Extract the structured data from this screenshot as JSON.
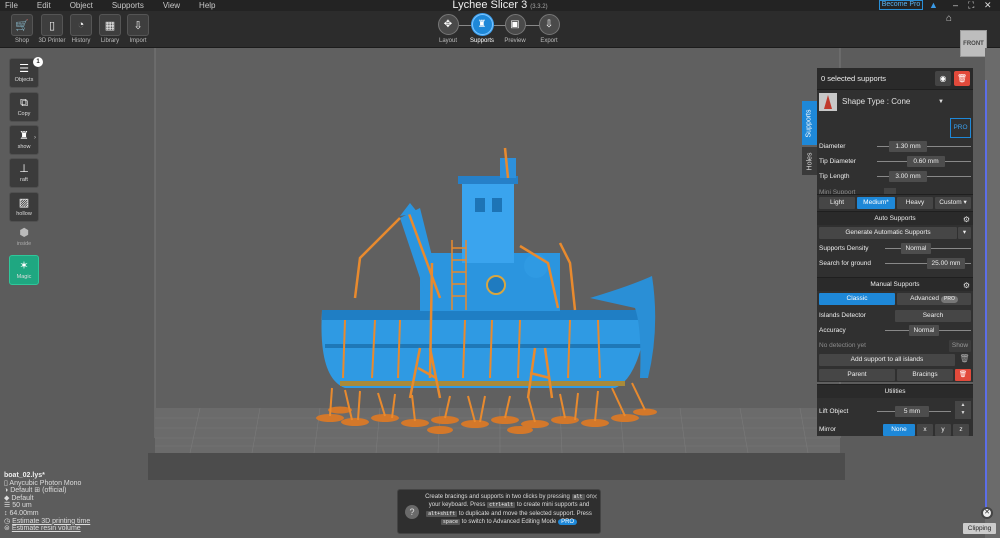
{
  "app": {
    "title": "Lychee Slicer 3",
    "version": "(3.3.2)",
    "become_pro": "Become Pro"
  },
  "menu": [
    "File",
    "Edit",
    "Object",
    "Supports",
    "View",
    "Help"
  ],
  "toolbar": {
    "tools": [
      {
        "label": "Shop",
        "icon": "cart-icon"
      },
      {
        "label": "3D Printer",
        "icon": "printer-icon"
      },
      {
        "label": "History",
        "icon": "history-icon"
      },
      {
        "label": "Library",
        "icon": "library-icon"
      },
      {
        "label": "Import",
        "icon": "import-icon"
      }
    ],
    "steps": [
      {
        "label": "Layout",
        "active": false
      },
      {
        "label": "Supports",
        "active": true
      },
      {
        "label": "Preview",
        "active": false
      },
      {
        "label": "Export",
        "active": false
      }
    ]
  },
  "left_tools": [
    {
      "label": "Objects",
      "icon": "list-icon"
    },
    {
      "label": "Copy",
      "icon": "copy-icon"
    },
    {
      "label": "show",
      "icon": "show-icon"
    },
    {
      "label": "raft",
      "icon": "raft-icon"
    },
    {
      "label": "hollow",
      "icon": "hollow-icon"
    },
    {
      "label": "inside",
      "icon": "inside-icon"
    },
    {
      "label": "Magic",
      "icon": "magic-icon"
    }
  ],
  "objects_count": "1",
  "viewcube_label": "FRONT",
  "file_info": {
    "filename": "boat_02.lys*",
    "printer": "Anycubic Photon Mono",
    "resin": "Default",
    "resin_suffix": "(official)",
    "profile": "Default",
    "layer_height": "50 um",
    "height": "64.00mm",
    "estimate_time": "Estimate 3D printing time",
    "estimate_resin": "Estimate resin volume"
  },
  "tip": {
    "part1": "Create bracings and supports in two clicks by pressing",
    "key_alt": "alt",
    "part2": "on your keyboard. Press",
    "key_ctrl_alt": "ctrl+alt",
    "part3": "to create mini supports and",
    "key_alt_shift": "alt+shift",
    "part4": "to duplicate and move the selected support.",
    "part5": "Press",
    "key_space": "space",
    "part6": "to switch to Advanced Editing Mode",
    "pro": "PRO"
  },
  "side_tabs": {
    "supports": "Supports",
    "holes": "Holes"
  },
  "panel": {
    "selected": "0 selected supports",
    "shape_type": "Shape Type : Cone",
    "pro": "PRO",
    "diameter_label": "Diameter",
    "diameter": "1.30 mm",
    "tip_diameter_label": "Tip Diameter",
    "tip_diameter": "0.60 mm",
    "tip_length_label": "Tip Length",
    "tip_length": "3.00 mm",
    "mini_support": "Mini Support",
    "presets": [
      "Light",
      "Medium*",
      "Heavy",
      "Custom ▾"
    ],
    "auto_title": "Auto Supports",
    "generate": "Generate Automatic Supports",
    "density_label": "Supports Density",
    "density": "Normal",
    "search_ground_label": "Search for ground",
    "search_ground": "25.00 mm",
    "manual_title": "Manual Supports",
    "classic": "Classic",
    "advanced": "Advanced",
    "adv_pro": "PRO",
    "islands_label": "Islands Detector",
    "search": "Search",
    "accuracy_label": "Accuracy",
    "accuracy": "Normal",
    "no_detection": "No detection yet",
    "show": "Show",
    "add_all": "Add support to all islands",
    "parent": "Parent",
    "bracings": "Bracings",
    "utilities_title": "Utilities",
    "lift_label": "Lift Object",
    "lift": "5 mm",
    "mirror_label": "Mirror",
    "mirror_opts": [
      "None",
      "x",
      "y",
      "z"
    ]
  },
  "clipping": "Clipping",
  "colors": {
    "accent": "#1e88d8",
    "model": "#2b9be6",
    "supports": "#e88a2e",
    "danger": "#e24a3b",
    "magic": "#1fa781"
  }
}
